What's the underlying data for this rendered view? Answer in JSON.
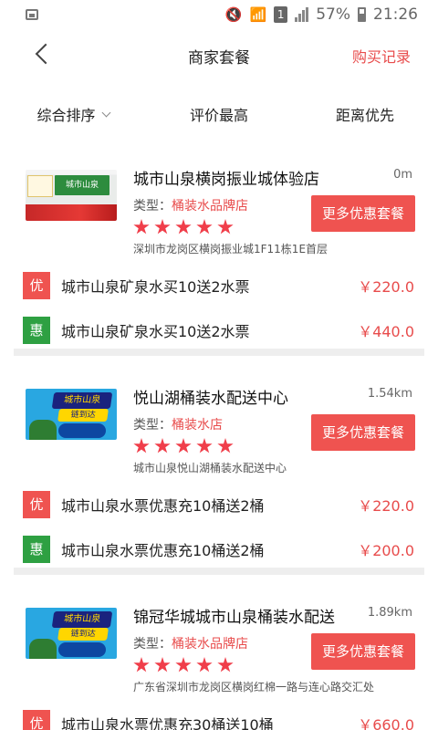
{
  "status_bar": {
    "battery": "57%",
    "time": "21:26",
    "sim": "1"
  },
  "header": {
    "title": "商家套餐",
    "right_link": "购买记录"
  },
  "sort_bar": {
    "items": [
      "综合排序",
      "评价最高",
      "距离优先"
    ]
  },
  "labels": {
    "type_prefix": "类型：",
    "more_button": "更多优惠套餐"
  },
  "stores": [
    {
      "name": "城市山泉横岗振业城体验店",
      "distance": "0m",
      "type": "桶装水品牌店",
      "rating": 5,
      "address": "深圳市龙岗区横岗振业城1F11栋1E首层",
      "deals": [
        {
          "badge": "优",
          "title": "城市山泉矿泉水买10送2水票",
          "price": "￥220.0"
        },
        {
          "badge": "惠",
          "title": "城市山泉矿泉水买10送2水票",
          "price": "￥440.0"
        }
      ]
    },
    {
      "name": "悦山湖桶装水配送中心",
      "distance": "1.54km",
      "type": "桶装水店",
      "rating": 5,
      "address": "城市山泉悦山湖桶装水配送中心",
      "deals": [
        {
          "badge": "优",
          "title": "城市山泉水票优惠充10桶送2桶",
          "price": "￥220.0"
        },
        {
          "badge": "惠",
          "title": "城市山泉水票优惠充10桶送2桶",
          "price": "￥200.0"
        }
      ]
    },
    {
      "name": "锦冠华城城市山泉桶装水配送",
      "distance": "1.89km",
      "type": "桶装水品牌店",
      "rating": 5,
      "address": "广东省深圳市龙岗区横岗红棉一路与连心路交汇处",
      "deals": [
        {
          "badge": "优",
          "title": "城市山泉水票优惠充30桶送10桶",
          "price": "￥660.0"
        }
      ]
    }
  ],
  "thumbnails": {
    "store1_sign": "城市山泉",
    "blue_title": "城市山泉",
    "blue_sub": "链到达"
  },
  "colors": {
    "accent_red": "#ef5350",
    "price_red": "#e84c4c",
    "badge_green": "#2ea042"
  }
}
